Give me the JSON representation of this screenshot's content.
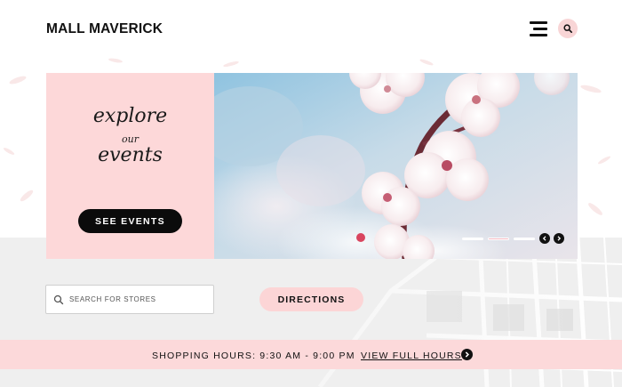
{
  "header": {
    "brand": "MALL MAVERICK",
    "menu_icon": "hamburger-menu-icon",
    "search_icon": "search-icon"
  },
  "hero": {
    "line1": "explore",
    "line2": "our",
    "line3": "events",
    "cta_label": "SEE EVENTS",
    "slide_count": 3,
    "active_slide": 2,
    "prev_icon": "chevron-left-icon",
    "next_icon": "chevron-right-icon"
  },
  "search": {
    "placeholder": "SEARCH FOR STORES",
    "value": ""
  },
  "directions": {
    "label": "DIRECTIONS"
  },
  "hours": {
    "text": "SHOPPING HOURS: 9:30 AM - 9:00 PM",
    "link_label": "VIEW FULL HOURS",
    "arrow_icon": "chevron-right-icon"
  },
  "colors": {
    "accent_pink": "#fdd8d9",
    "dark": "#0b0b0b",
    "map_gray": "#efefef"
  }
}
